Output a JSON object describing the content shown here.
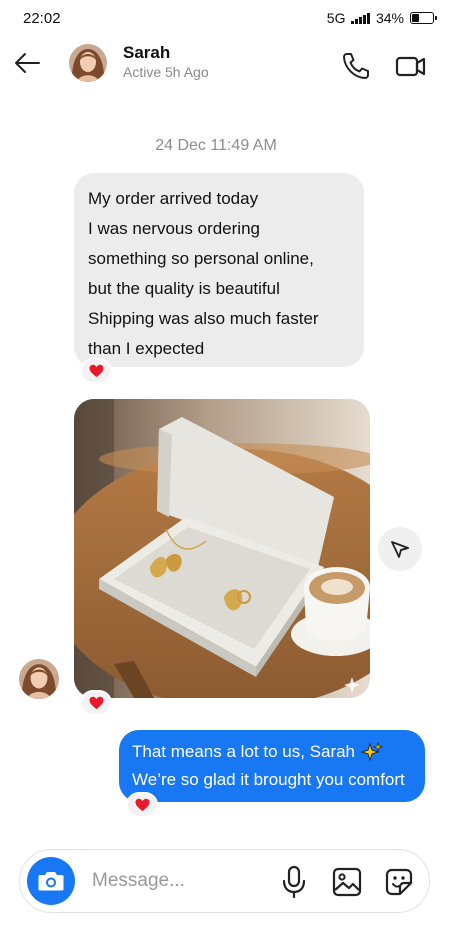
{
  "status_bar": {
    "time": "22:02",
    "network": "5G",
    "battery": "34%",
    "battery_level": 0.34
  },
  "header": {
    "contact_name": "Sarah",
    "contact_status": "Active 5h Ago"
  },
  "chat": {
    "timestamp": "24 Dec 11:49 AM",
    "messages": [
      {
        "direction": "incoming",
        "lines": [
          "My order arrived today",
          "I was nervous ordering",
          "something so personal online,",
          "but the quality is beautiful",
          "Shipping was also much faster",
          "than I expected"
        ],
        "reaction": "heart-icon"
      },
      {
        "direction": "incoming",
        "type": "photo",
        "reaction": "heart-icon"
      },
      {
        "direction": "outgoing",
        "lines": [
          "That means a lot to us, Sarah",
          "We’re so glad it brought you comfort"
        ],
        "emoji": "sparkles-icon",
        "reaction": "heart-icon"
      }
    ]
  },
  "composer": {
    "placeholder": "Message..."
  },
  "colors": {
    "accent": "#1877f2",
    "incoming_bubble": "#ececec",
    "reaction_heart": "#e8192c",
    "muted_text": "#8e8e8e"
  }
}
